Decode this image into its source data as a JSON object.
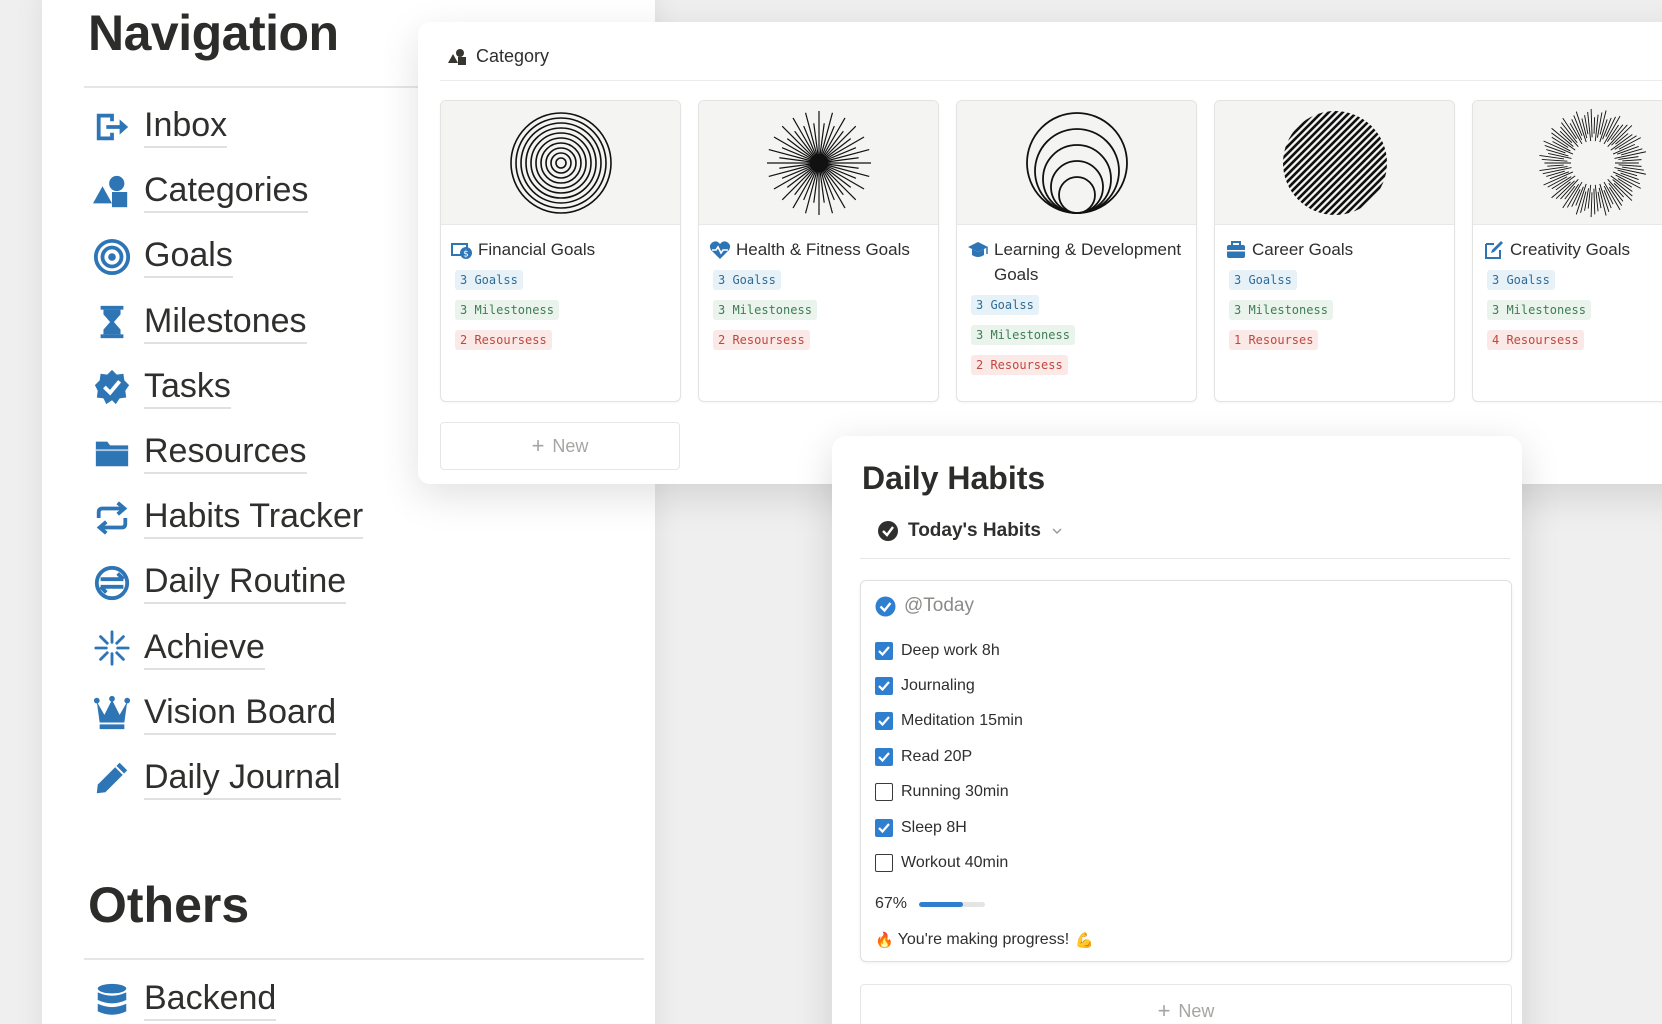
{
  "navigation": {
    "title": "Navigation",
    "items": [
      {
        "label": "Inbox",
        "icon": "inbox-icon"
      },
      {
        "label": "Categories",
        "icon": "shapes-icon"
      },
      {
        "label": "Goals",
        "icon": "target-icon"
      },
      {
        "label": "Milestones",
        "icon": "hourglass-icon"
      },
      {
        "label": "Tasks",
        "icon": "verified-badge-icon"
      },
      {
        "label": "Resources",
        "icon": "folder-icon"
      },
      {
        "label": "Habits Tracker",
        "icon": "repeat-icon"
      },
      {
        "label": "Daily Routine",
        "icon": "routine-icon"
      },
      {
        "label": "Achieve",
        "icon": "sparkle-icon"
      },
      {
        "label": "Vision Board",
        "icon": "crown-icon"
      },
      {
        "label": "Daily Journal",
        "icon": "pencil-icon"
      }
    ],
    "accent": "#2e75b6"
  },
  "others": {
    "title": "Others",
    "items": [
      {
        "label": "Backend",
        "icon": "database-icon"
      }
    ]
  },
  "category": {
    "header": "Category",
    "new_label": "New",
    "cards": [
      {
        "title": "Financial Goals",
        "icon": "money-icon",
        "cover": "concentric-rings",
        "goals": "3 Goalss",
        "milestones": "3 Milestoness",
        "resources": "2 Resoursess"
      },
      {
        "title": "Health & Fitness Goals",
        "icon": "heart-pulse-icon",
        "cover": "starburst",
        "goals": "3 Goalss",
        "milestones": "3 Milestoness",
        "resources": "2 Resoursess"
      },
      {
        "title": "Learning & Development Goals",
        "icon": "graduation-cap-icon",
        "cover": "nested-circles",
        "goals": "3 Goalss",
        "milestones": "3 Milestoness",
        "resources": "2 Resoursess"
      },
      {
        "title": "Career Goals",
        "icon": "briefcase-icon",
        "cover": "diagonal-lines",
        "goals": "3 Goalss",
        "milestones": "3 Milestoness",
        "resources": "1 Resourses"
      },
      {
        "title": "Creativity Goals",
        "icon": "edit-icon",
        "cover": "radial-burst",
        "goals": "3 Goalss",
        "milestones": "3 Milestoness",
        "resources": "4 Resoursess"
      }
    ]
  },
  "habits": {
    "title": "Daily Habits",
    "view_label": "Today's Habits",
    "date_label": "@Today",
    "items": [
      {
        "label": "Deep work 8h",
        "checked": true
      },
      {
        "label": "Journaling",
        "checked": true
      },
      {
        "label": "Meditation 15min",
        "checked": true
      },
      {
        "label": "Read 20P",
        "checked": true
      },
      {
        "label": "Running 30min",
        "checked": false
      },
      {
        "label": "Sleep 8H",
        "checked": true
      },
      {
        "label": "Workout 40min",
        "checked": false
      }
    ],
    "progress_text": "67%",
    "progress_value": 0.67,
    "message": "You're making progress!",
    "message_emoji_left": "🔥",
    "message_emoji_right": "💪",
    "new_label": "New"
  }
}
